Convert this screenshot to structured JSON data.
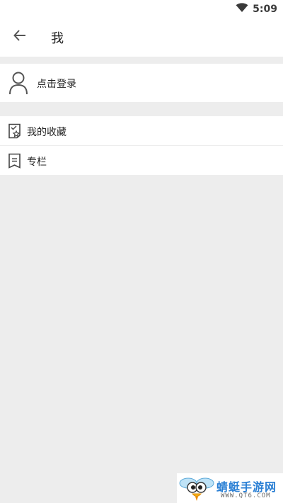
{
  "status_bar": {
    "time": "5:09",
    "wifi_icon": "wifi-icon"
  },
  "header": {
    "back_icon": "arrow-left-icon",
    "title": "我"
  },
  "login": {
    "avatar_icon": "user-avatar-icon",
    "label": "点击登录"
  },
  "menu": {
    "items": [
      {
        "icon": "favorites-star-icon",
        "label": "我的收藏"
      },
      {
        "icon": "column-bookmark-icon",
        "label": "专栏"
      }
    ]
  },
  "watermark": {
    "brand": "蜻蜓手游网",
    "url": "WWW.QT6.COM",
    "brand_color": "#2a7fd4"
  },
  "colors": {
    "background": "#ededed",
    "surface": "#ffffff",
    "text_primary": "#222222",
    "icon_gray": "#555555"
  }
}
